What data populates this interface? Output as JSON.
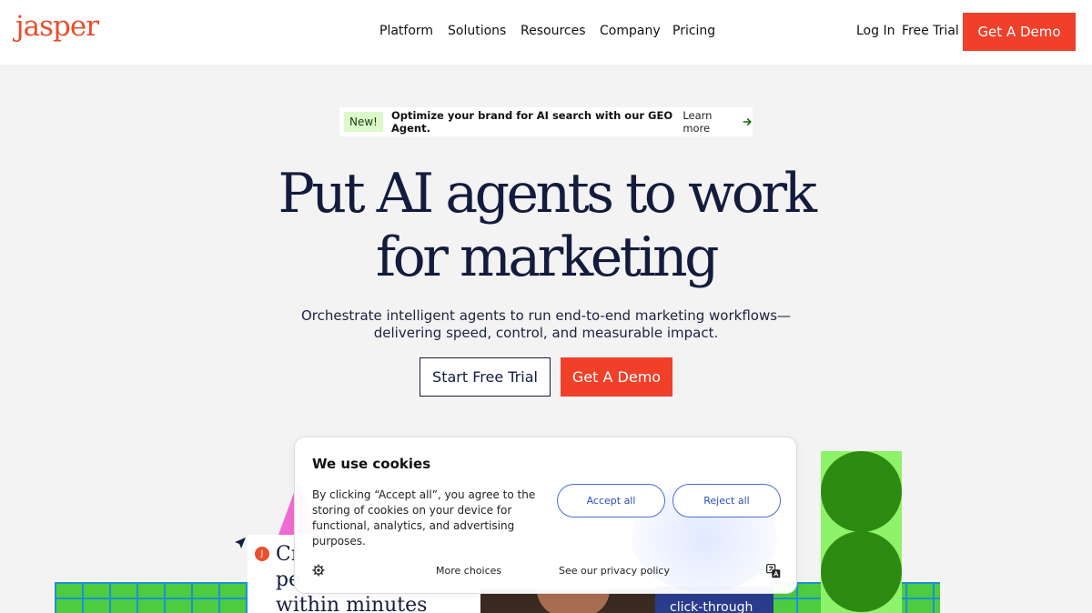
{
  "nav": {
    "logo": "jasper",
    "links": [
      "Platform",
      "Solutions",
      "Resources",
      "Company",
      "Pricing"
    ],
    "login": "Log In",
    "free_trial": "Free Trial",
    "demo": "Get A Demo"
  },
  "announcement": {
    "badge": "New!",
    "text": "Optimize your brand for AI search with our GEO Agent.",
    "link": "Learn more"
  },
  "hero": {
    "headline_line1": "Put AI agents to work",
    "headline_line2": "for marketing",
    "subtitle_line1": "Orchestrate intelligent agents to run end-to-end marketing workflows—",
    "subtitle_line2": "delivering speed, control, and measurable impact.",
    "btn_trial": "Start Free Trial",
    "btn_demo": "Get A Demo"
  },
  "preview": {
    "card_line1": "Cr",
    "card_line2": "pe",
    "card_line3": "within minutes",
    "badge": "J",
    "blue_text": "click-through"
  },
  "cookie": {
    "title": "We use cookies",
    "body": "By clicking “Accept all”, you agree to the storing of cookies on your device for functional, analytics, and advertising purposes.",
    "accept": "Accept all",
    "reject": "Reject all",
    "more": "More choices",
    "privacy": "See our privacy policy"
  },
  "colors": {
    "brand": "#f0402a",
    "navy": "#141c3e",
    "badge_bg": "#dbfac9",
    "cookie_btn": "#4a6fd6"
  }
}
